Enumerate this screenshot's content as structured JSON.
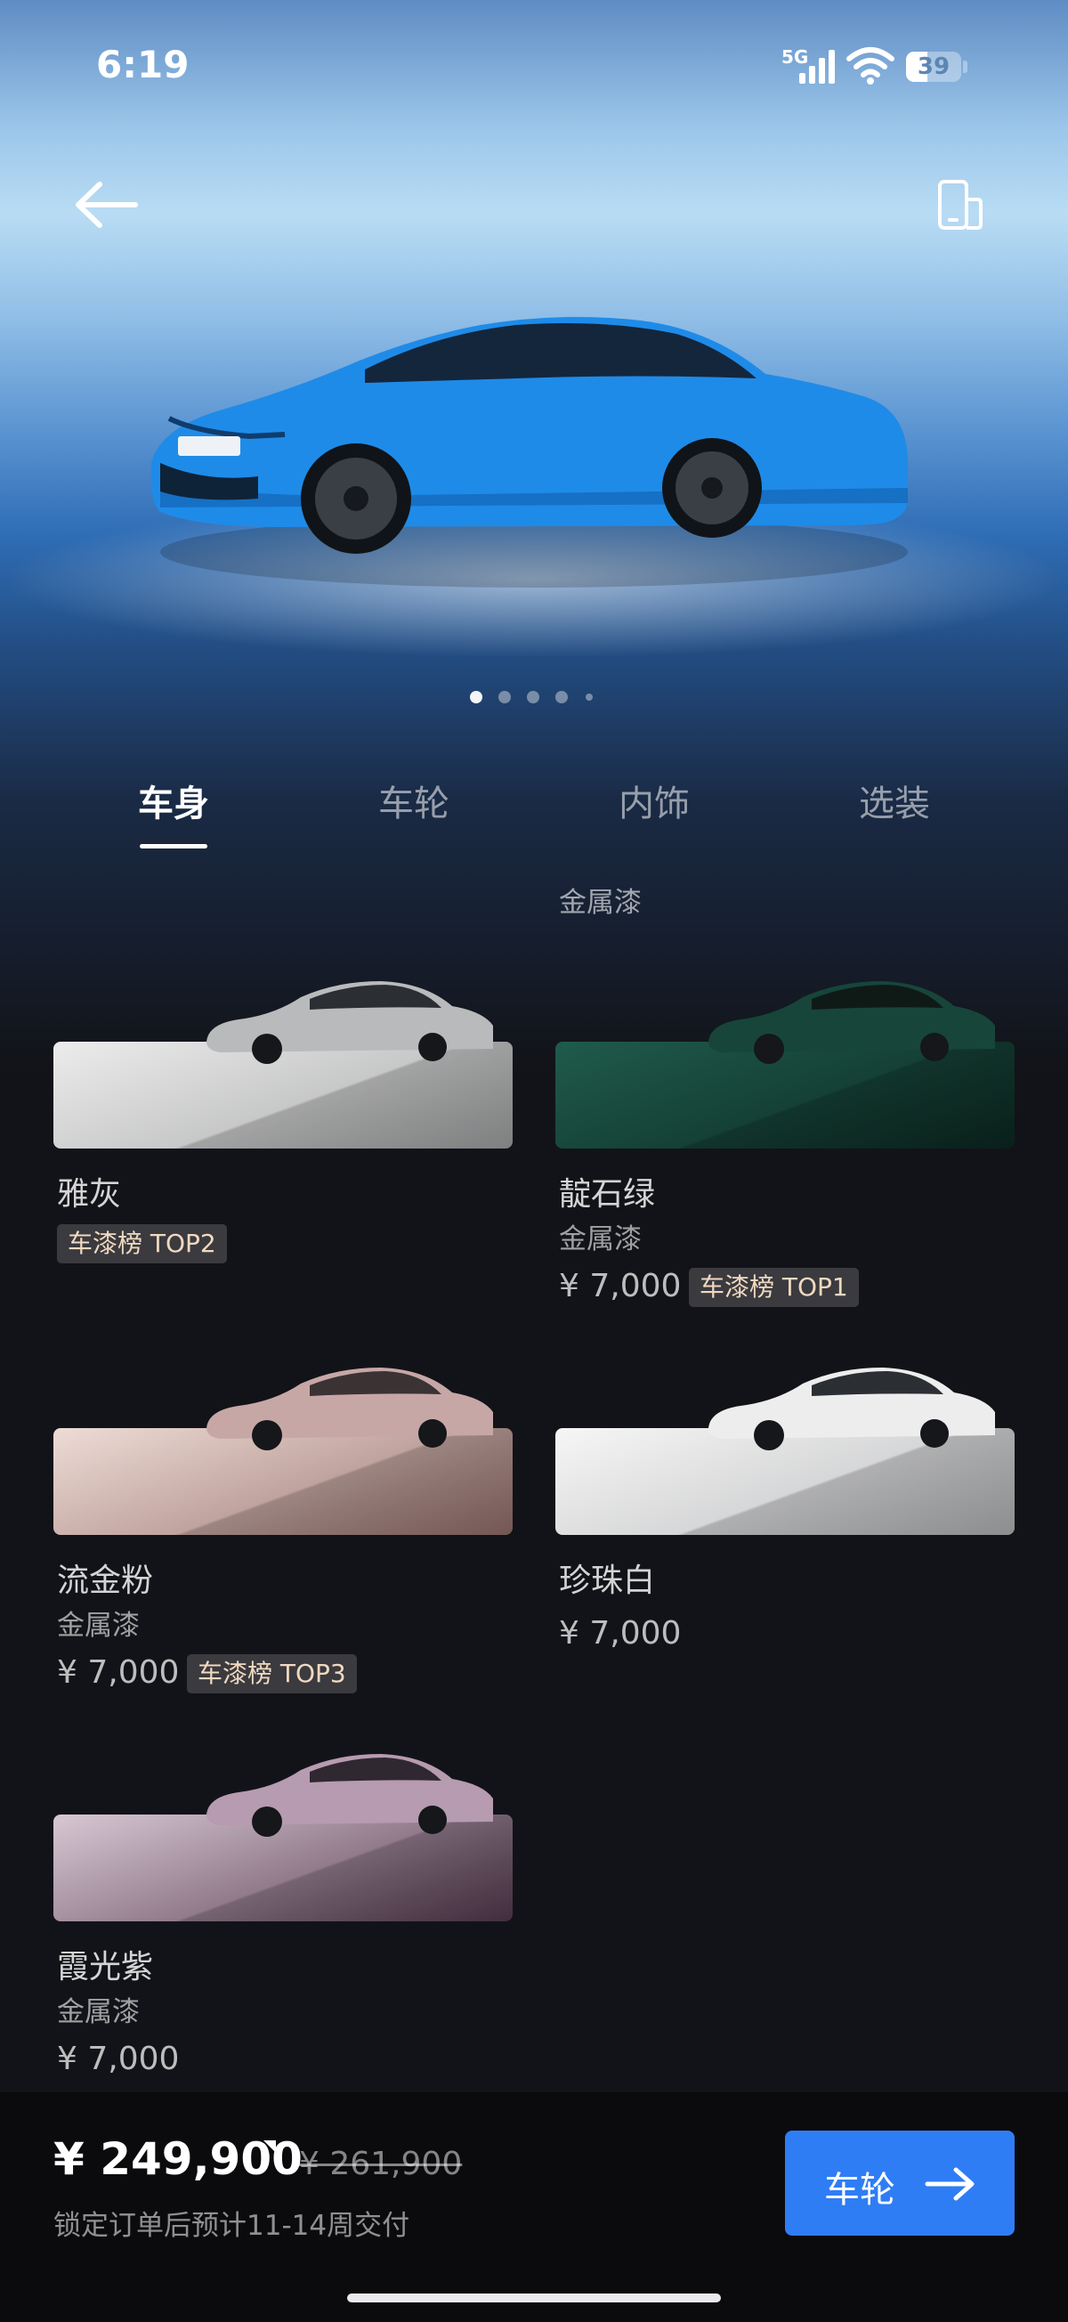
{
  "status_bar": {
    "time": "6:19",
    "network": "5G",
    "battery_level": "39",
    "icons": [
      "signal-icon",
      "wifi-icon",
      "battery-icon"
    ]
  },
  "header": {
    "back_icon": "arrow-left-icon",
    "device_icon": "device-switch-icon"
  },
  "gallery": {
    "page_count": 5,
    "active_index": 0
  },
  "tabs": [
    {
      "label": "车身",
      "active": true
    },
    {
      "label": "车轮",
      "active": false
    },
    {
      "label": "内饰",
      "active": false
    },
    {
      "label": "选装",
      "active": false
    }
  ],
  "section_label": "金属漆",
  "colors": [
    {
      "name": "雅灰",
      "subtitle": "",
      "price": "",
      "badge": "车漆榜 TOP2",
      "swatch": [
        "#e6e6e6",
        "#a9aaab"
      ],
      "car": "#b9babb"
    },
    {
      "name": "靛石绿",
      "subtitle": "金属漆",
      "price": "¥ 7,000",
      "badge": "车漆榜 TOP1",
      "swatch": [
        "#1c5647",
        "#0d2c25"
      ],
      "car": "#17453a"
    },
    {
      "name": "流金粉",
      "subtitle": "金属漆",
      "price": "¥ 7,000",
      "badge": "车漆榜 TOP3",
      "swatch": [
        "#ead6d0",
        "#9c7772"
      ],
      "car": "#c7a7a6"
    },
    {
      "name": "珍珠白",
      "subtitle": "",
      "price": "¥ 7,000",
      "badge": "",
      "swatch": [
        "#f4f4f4",
        "#bdbec0"
      ],
      "car": "#ededed"
    },
    {
      "name": "霞光紫",
      "subtitle": "金属漆",
      "price": "¥ 7,000",
      "badge": "",
      "swatch": [
        "#d4c2cf",
        "#5a3f55"
      ],
      "car": "#b79bb0"
    }
  ],
  "footer": {
    "price": "¥ 249,900",
    "old_price": "¥ 261,900",
    "delivery_note": "锁定订单后预计11-14周交付",
    "next_button": "车轮",
    "next_icon": "arrow-right-icon"
  },
  "theme": {
    "accent": "#2f7df5",
    "hero_car": "#1f8be8",
    "badge_text": "#f0d9c0"
  }
}
